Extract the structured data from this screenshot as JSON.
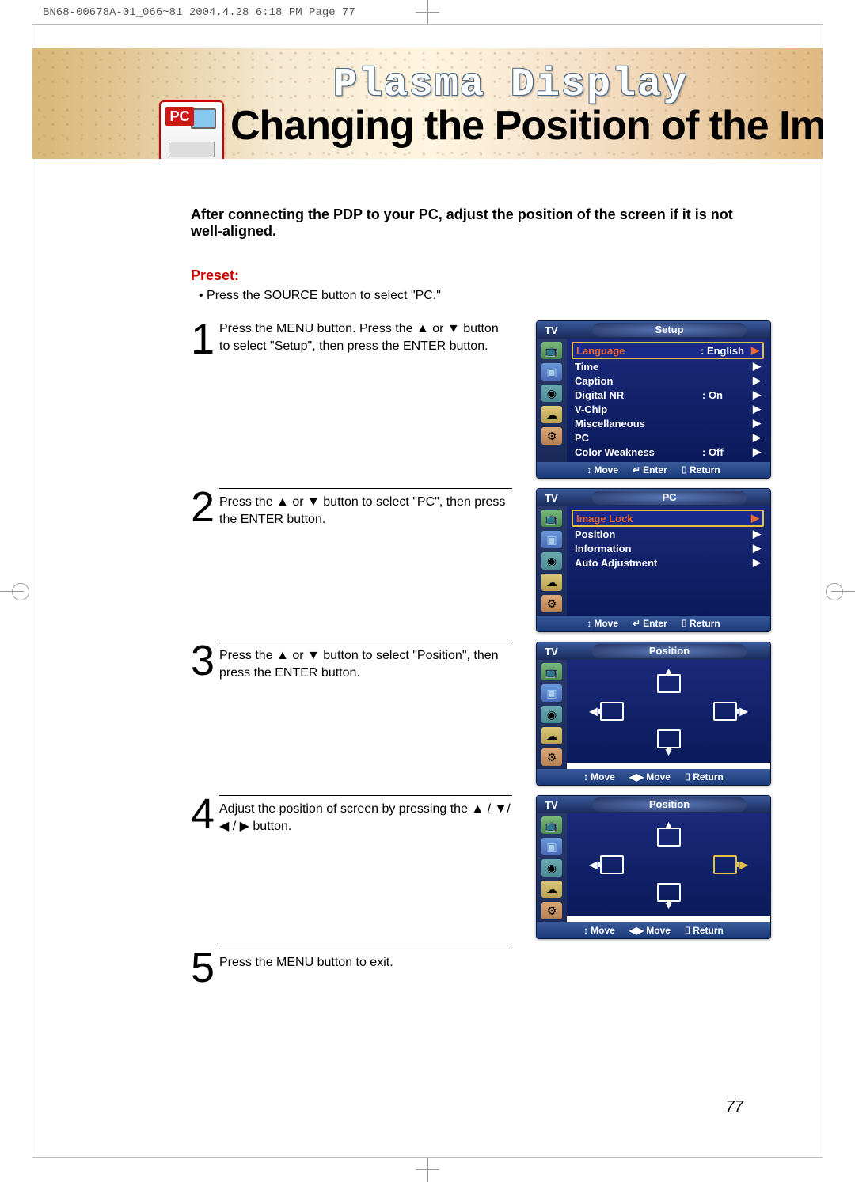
{
  "print_header": "BN68-00678A-01_066~81  2004.4.28  6:18 PM  Page 77",
  "brand_title": "Plasma Display",
  "page_title": "Changing the Position of the Image",
  "pc_badge": "PC",
  "intro": "After connecting the PDP to your PC, adjust the position of the screen if it is not well-aligned.",
  "preset_label": "Preset:",
  "preset_text": "•   Press the SOURCE button to select \"PC.\"",
  "steps": [
    {
      "num": "1",
      "text": "Press the MENU button. Press the ▲ or ▼ button to select \"Setup\", then press the ENTER button."
    },
    {
      "num": "2",
      "text": "Press the ▲ or ▼ button to select \"PC\", then press the ENTER button."
    },
    {
      "num": "3",
      "text": "Press the ▲ or ▼ button to select \"Position\", then press the ENTER button."
    },
    {
      "num": "4",
      "text": "Adjust the position of screen by pressing the ▲ / ▼/ ◀ / ▶ button."
    },
    {
      "num": "5",
      "text": "Press the MENU button to exit."
    }
  ],
  "osd": {
    "tv": "TV",
    "setup_title": "Setup",
    "pc_title": "PC",
    "position_title": "Position",
    "setup_items": [
      {
        "label": "Language",
        "value": ":  English",
        "sel": true
      },
      {
        "label": "Time",
        "value": "",
        "sel": false
      },
      {
        "label": "Caption",
        "value": "",
        "sel": false
      },
      {
        "label": "Digital NR",
        "value": ":  On",
        "sel": false
      },
      {
        "label": "V-Chip",
        "value": "",
        "sel": false
      },
      {
        "label": "Miscellaneous",
        "value": "",
        "sel": false
      },
      {
        "label": "PC",
        "value": "",
        "sel": false
      },
      {
        "label": "Color Weakness",
        "value": ":  Off",
        "sel": false
      }
    ],
    "pc_items": [
      {
        "label": "Image Lock",
        "sel": true
      },
      {
        "label": "Position",
        "sel": false
      },
      {
        "label": "Information",
        "sel": false
      },
      {
        "label": "Auto Adjustment",
        "sel": false
      }
    ],
    "footer_move": "Move",
    "footer_enter": "Enter",
    "footer_return": "Return",
    "sym_updown": "↕",
    "sym_leftright": "◀▶",
    "sym_enter": "↵",
    "sym_return": "⌷"
  },
  "page_number": "77"
}
